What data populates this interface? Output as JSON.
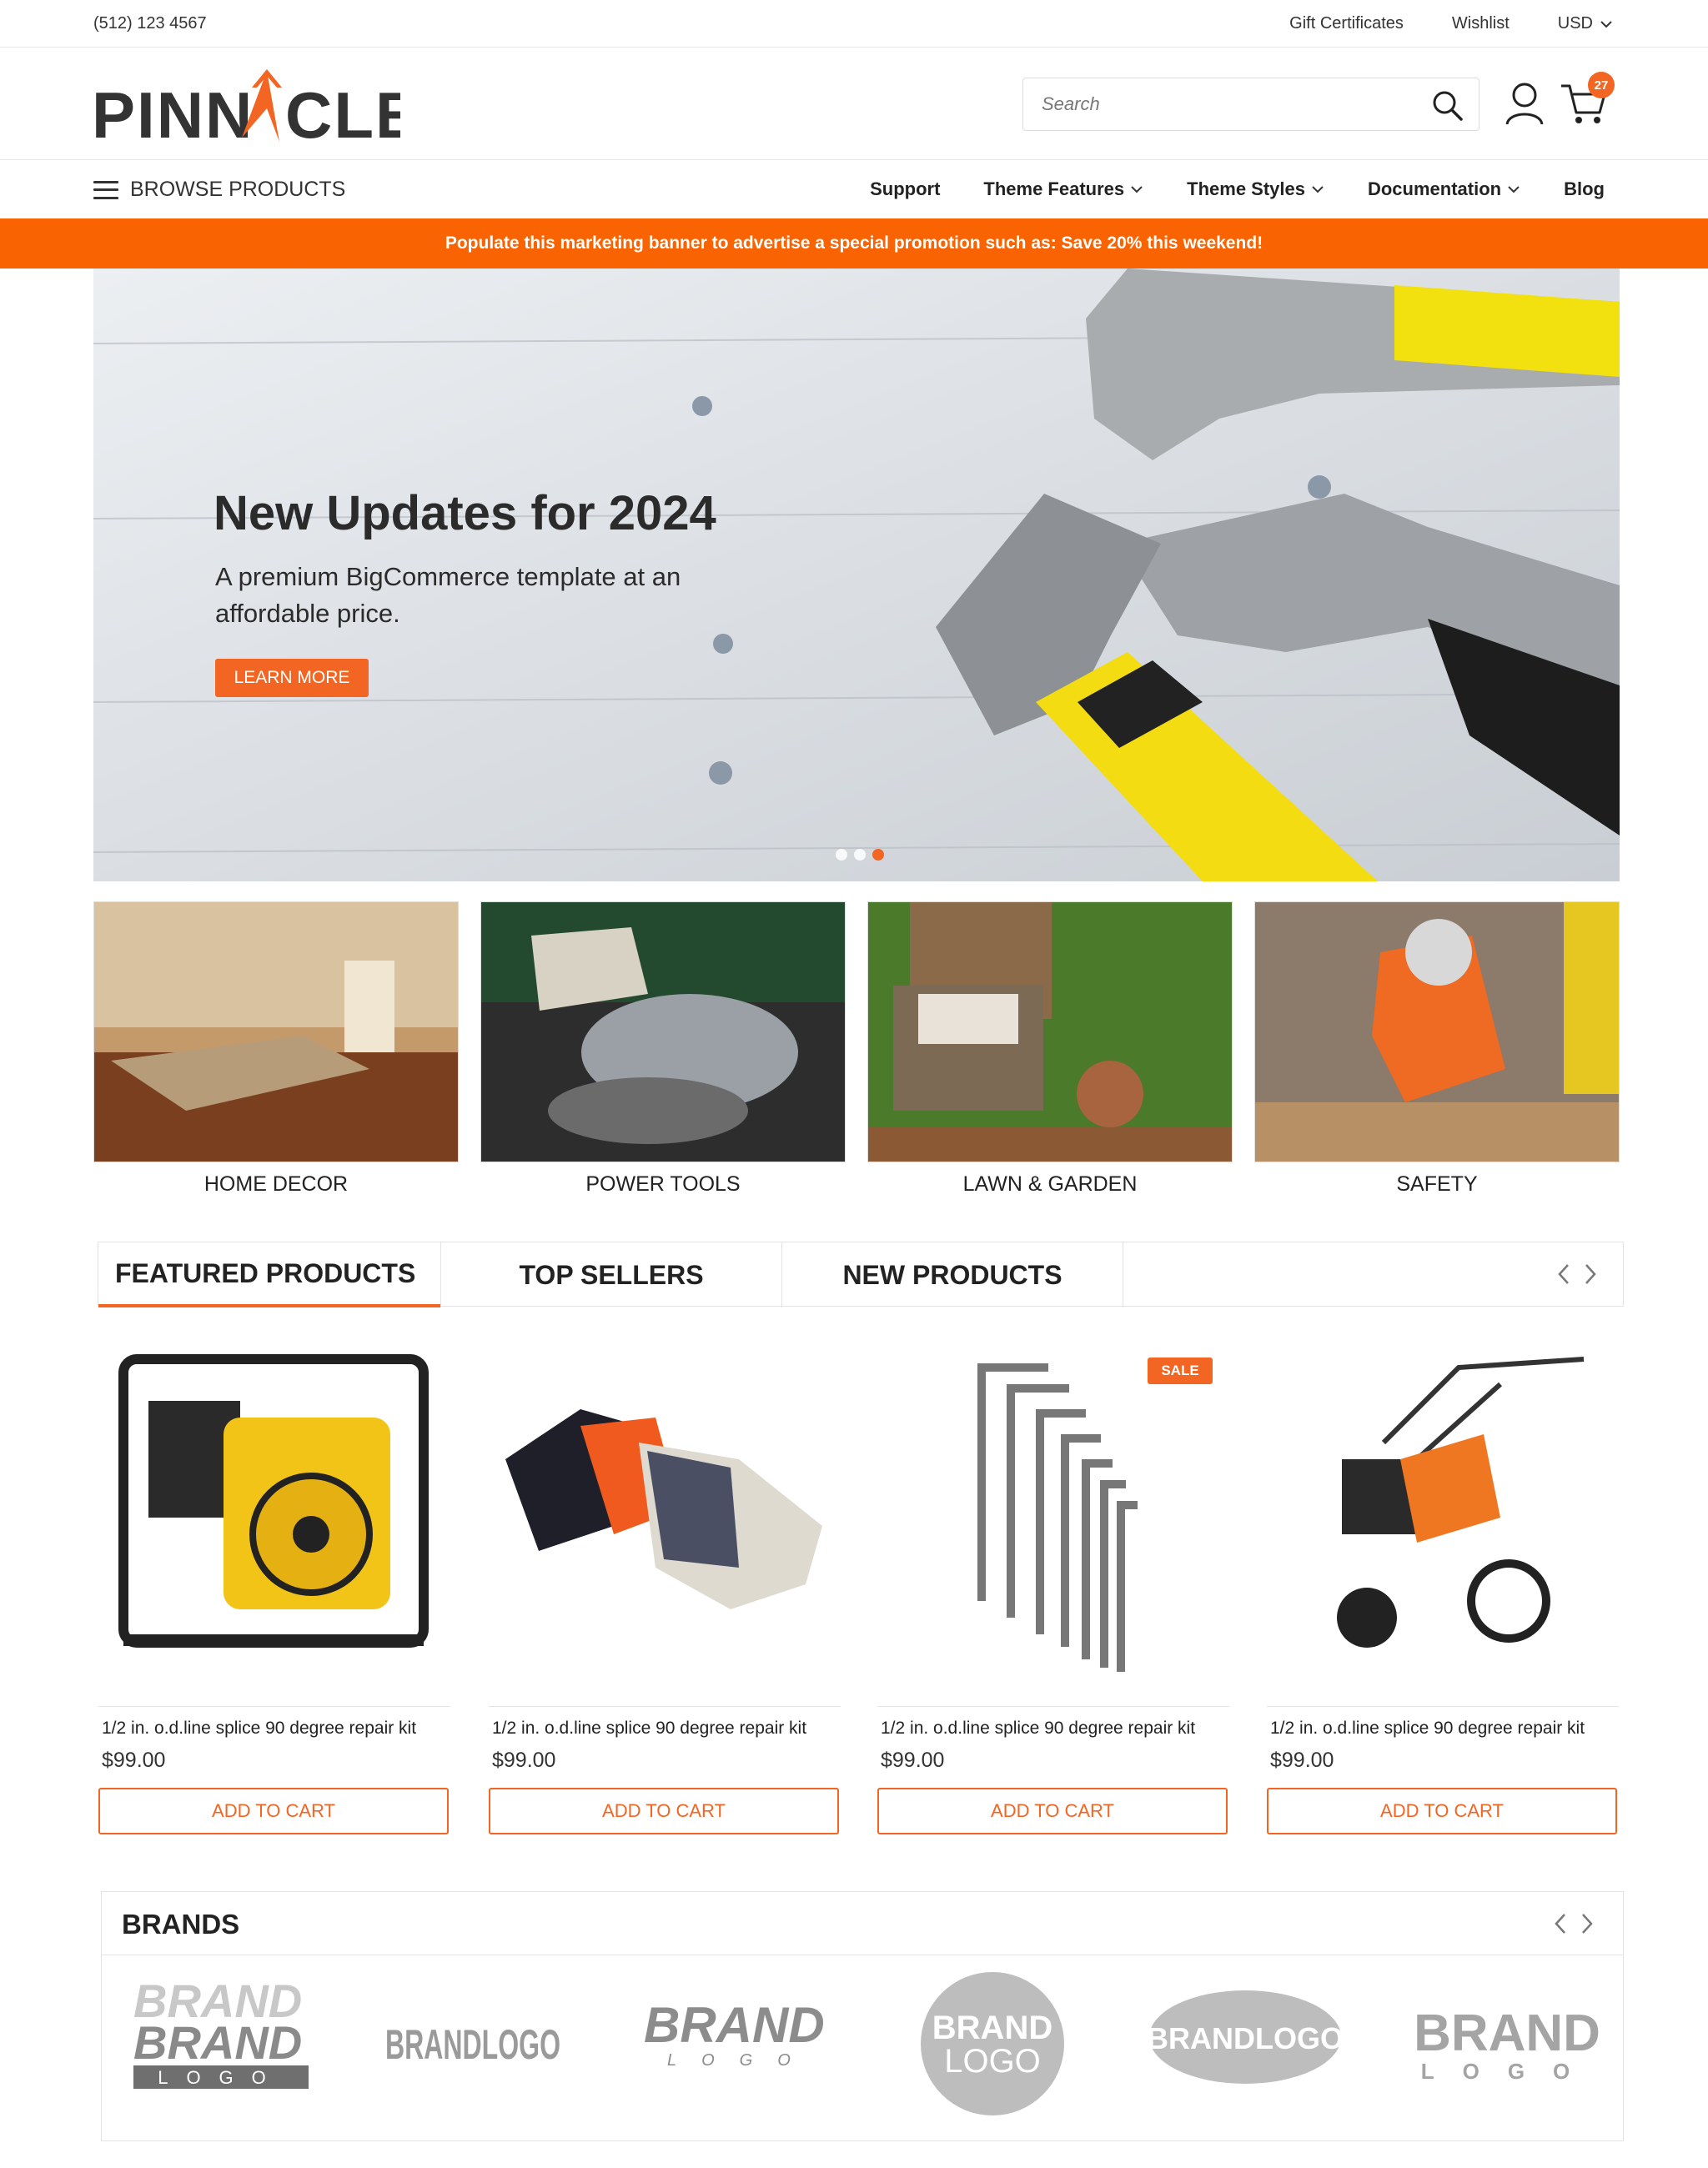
{
  "topbar": {
    "phone": "(512) 123 4567",
    "gift": "Gift Certificates",
    "wishlist": "Wishlist",
    "currency": "USD"
  },
  "header": {
    "logo": "PINNACLE",
    "search_placeholder": "Search",
    "cart_count": "27"
  },
  "nav": {
    "browse": "BROWSE PRODUCTS",
    "items": [
      "Support",
      "Theme Features",
      "Theme Styles",
      "Documentation",
      "Blog"
    ]
  },
  "promo": "Populate this marketing banner to advertise a special promotion such as: Save 20% this weekend!",
  "hero": {
    "title": "New Updates for 2024",
    "subtitle": "A premium BigCommerce template at an affordable price.",
    "button": "LEARN MORE",
    "slides": 3,
    "active_slide": 3
  },
  "categories": [
    "HOME DECOR",
    "POWER TOOLS",
    "LAWN & GARDEN",
    "SAFETY"
  ],
  "tabs": [
    "FEATURED PRODUCTS",
    "TOP SELLERS",
    "NEW PRODUCTS"
  ],
  "products": [
    {
      "name": "1/2 in. o.d.line splice 90 degree repair kit",
      "price": "$99.00",
      "button": "ADD TO CART"
    },
    {
      "name": "1/2 in. o.d.line splice 90 degree repair kit",
      "price": "$99.00",
      "button": "ADD TO CART"
    },
    {
      "name": "1/2 in. o.d.line splice 90 degree repair kit",
      "price": "$99.00",
      "button": "ADD TO CART",
      "badge": "SALE"
    },
    {
      "name": "1/2 in. o.d.line splice 90 degree repair kit",
      "price": "$99.00",
      "button": "ADD TO CART"
    }
  ],
  "brands": {
    "title": "BRANDS",
    "logos": [
      "BRAND BRAND LOGO",
      "BRANDLOGO",
      "BRAND LOGO",
      "BRAND LOGO",
      "BRANDLOGO",
      "BRAND LOGO"
    ]
  },
  "colors": {
    "accent": "#f26522",
    "promo": "#f96302"
  }
}
